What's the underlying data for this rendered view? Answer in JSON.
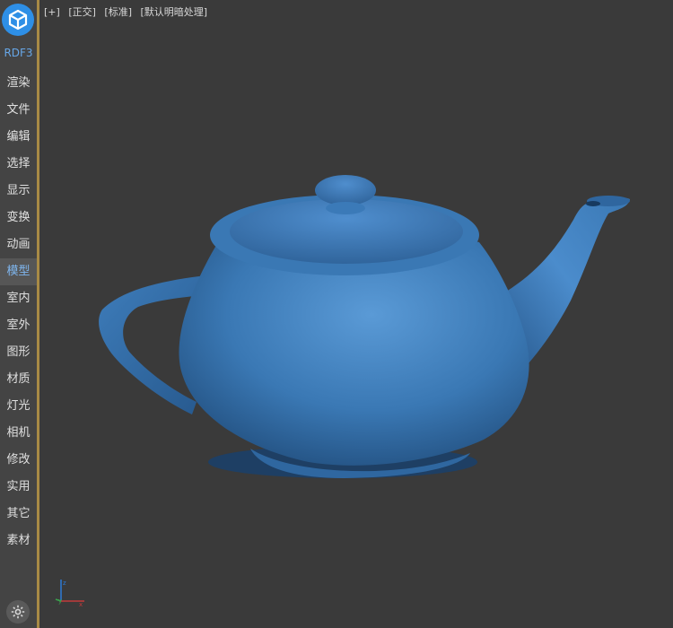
{
  "sidebar": {
    "brand": "RDF3",
    "items": [
      {
        "label": "渲染"
      },
      {
        "label": "文件"
      },
      {
        "label": "编辑"
      },
      {
        "label": "选择"
      },
      {
        "label": "显示"
      },
      {
        "label": "变换"
      },
      {
        "label": "动画"
      },
      {
        "label": "模型",
        "active": true
      },
      {
        "label": "室内"
      },
      {
        "label": "室外"
      },
      {
        "label": "图形"
      },
      {
        "label": "材质"
      },
      {
        "label": "灯光"
      },
      {
        "label": "相机"
      },
      {
        "label": "修改"
      },
      {
        "label": "实用"
      },
      {
        "label": "其它"
      },
      {
        "label": "素材"
      }
    ]
  },
  "viewport": {
    "labels": [
      "[+]",
      "[正交]",
      "[标准]",
      "[默认明暗处理]"
    ],
    "axis": {
      "x": "x",
      "y": "y",
      "z": "z"
    }
  },
  "colors": {
    "accent": "#2e8fe6",
    "active_text": "#7fb6ef",
    "teapot": "#3a78b4",
    "divider": "#a88a45"
  }
}
